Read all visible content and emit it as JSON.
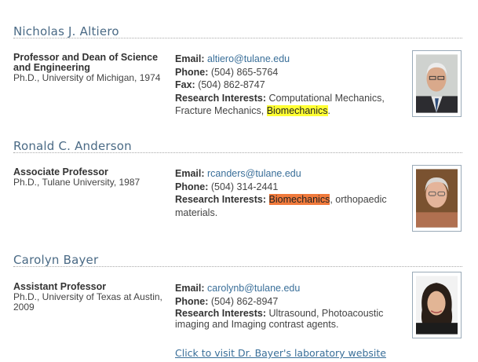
{
  "people": [
    {
      "name": "Nicholas J. Altiero",
      "role": "Professor and Dean of Science and Engineering",
      "degree": "Ph.D., University of Michigan, 1974",
      "email_label": "Email:",
      "email": "altiero@tulane.edu",
      "phone_label": "Phone:",
      "phone": "(504) 865-5764",
      "fax_label": "Fax:",
      "fax": "(504) 862-8747",
      "interests_label": "Research Interests:",
      "interests_before": "Computational Mechanics, Fracture Mechanics,",
      "interests_highlight": "Biomechanics",
      "interests_after": "."
    },
    {
      "name": "Ronald C. Anderson",
      "role": "Associate Professor",
      "degree": "Ph.D., Tulane University, 1987",
      "email_label": "Email:",
      "email": "rcanders@tulane.edu",
      "phone_label": "Phone:",
      "phone": "(504) 314-2441",
      "interests_label": "Research Interests:",
      "interests_highlight": "Biomechanics",
      "interests_after": ", orthopaedic materials."
    },
    {
      "name": "Carolyn Bayer",
      "role": "Assistant Professor",
      "degree": "Ph.D., University of Texas at Austin, 2009",
      "email_label": "Email:",
      "email": "carolynb@tulane.edu",
      "phone_label": "Phone:",
      "phone": "(504) 862-8947",
      "interests_label": "Research Interests:",
      "interests_text": "Ultrasound, Photoacoustic imaging and Imaging contrast agents.",
      "link_text": "Click to visit Dr. Bayer's laboratory website"
    }
  ],
  "colors": {
    "name": "#4a6a85",
    "link": "#3a6f99",
    "highlight_yellow": "#ffff33",
    "highlight_orange": "#f07a3c"
  }
}
